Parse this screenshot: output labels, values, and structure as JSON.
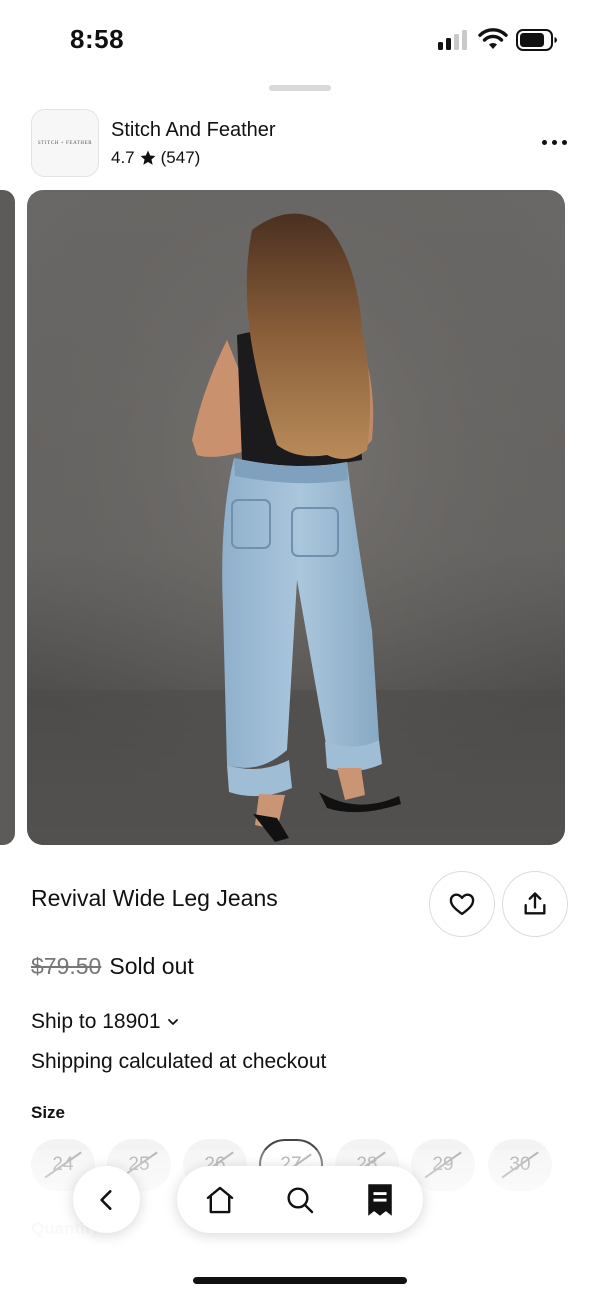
{
  "status_bar": {
    "time": "8:58",
    "icons": [
      "signal-icon",
      "wifi-icon",
      "battery-icon"
    ]
  },
  "shop": {
    "name": "Stitch And Feather",
    "rating": "4.7",
    "review_count": "(547)",
    "logo_text": "STITCH + FEATHER"
  },
  "product": {
    "title": "Revival Wide Leg Jeans",
    "original_price": "$79.50",
    "availability": "Sold out",
    "ship_to": "Ship to 18901",
    "shipping_note": "Shipping calculated at checkout",
    "size_label": "Size",
    "sizes": [
      {
        "label": "24",
        "available": false,
        "selected": false
      },
      {
        "label": "25",
        "available": false,
        "selected": false
      },
      {
        "label": "26",
        "available": false,
        "selected": false
      },
      {
        "label": "27",
        "available": false,
        "selected": true
      },
      {
        "label": "28",
        "available": false,
        "selected": false
      },
      {
        "label": "29",
        "available": false,
        "selected": false
      },
      {
        "label": "30",
        "available": false,
        "selected": false
      }
    ],
    "quantity_label": "Quantity"
  },
  "actions": {
    "favorite_icon": "heart-icon",
    "share_icon": "share-icon",
    "more_icon": "more-horizontal-icon"
  },
  "bottom_nav": {
    "back_icon": "chevron-left-icon",
    "items": [
      {
        "id": "home",
        "icon": "home-icon"
      },
      {
        "id": "search",
        "icon": "search-icon"
      },
      {
        "id": "orders",
        "icon": "receipt-icon",
        "active": true
      }
    ]
  },
  "colors": {
    "text": "#111111",
    "muted": "#777777",
    "chip_bg": "#f3f3f3",
    "border": "#dcdcdc"
  }
}
